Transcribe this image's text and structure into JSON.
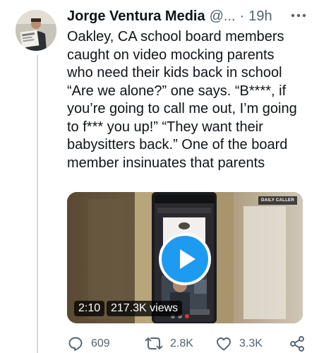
{
  "tweet": {
    "author_name": "Jorge Ventura Media",
    "author_handle": "@...",
    "separator": "·",
    "timestamp": "19h",
    "text_lines": [
      "Oakley, CA school board members",
      "caught on video mocking parents",
      "who need their kids back in school",
      "“Are we alone?” one says. “B****, if",
      "you’re going to call me out, I’m going",
      "to f*** you up!”  “They want their",
      "babysitters back.” One of the board",
      "member insinuates that parents"
    ]
  },
  "video": {
    "source_badge": "DAILY CALLER",
    "duration": "2:10",
    "views": "217.3K views"
  },
  "actions": {
    "replies": "609",
    "retweets": "2.8K",
    "likes": "3.3K"
  },
  "colors": {
    "accent": "#1d9bf0",
    "text_primary": "#0f1419",
    "text_secondary": "#536471",
    "thread_line": "#cfd9de"
  },
  "icons": {
    "more": "more-icon",
    "reply": "reply-icon",
    "retweet": "retweet-icon",
    "like": "heart-icon",
    "share": "share-icon",
    "play": "play-icon"
  }
}
